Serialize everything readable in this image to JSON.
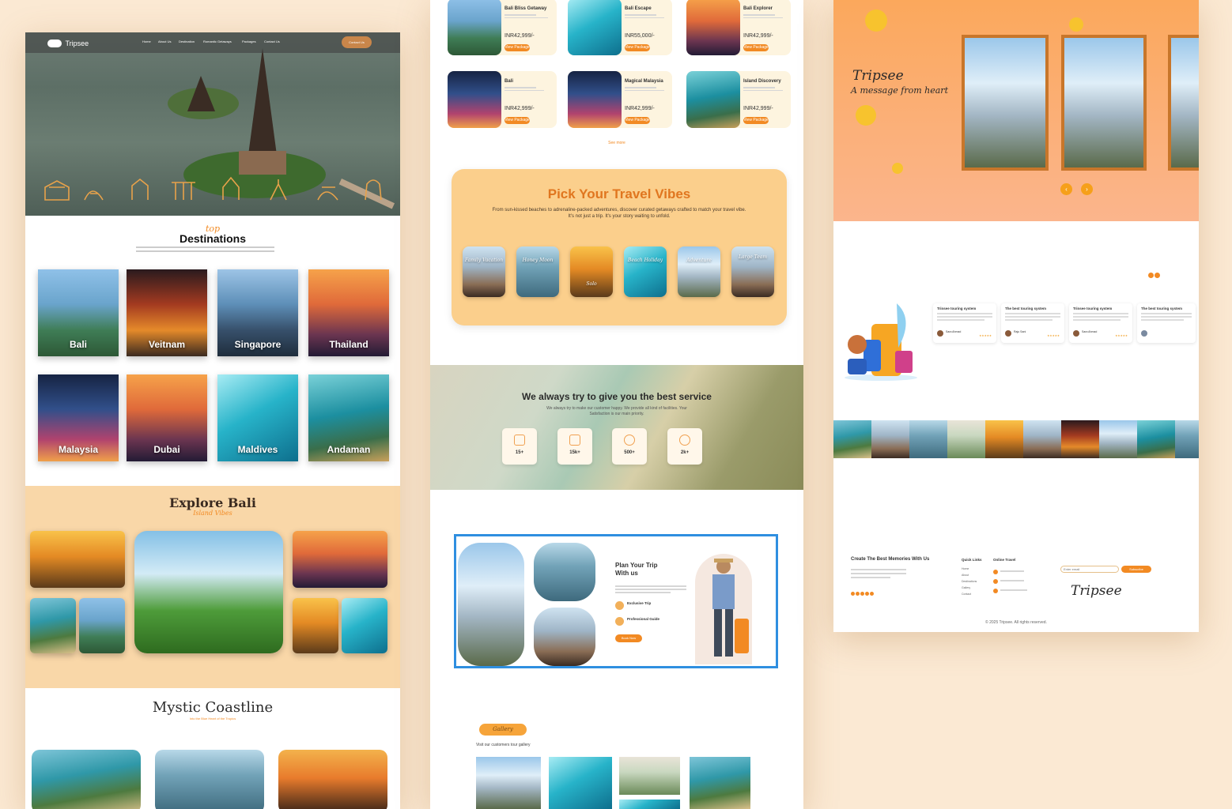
{
  "brand": {
    "name": "Tripsee"
  },
  "nav": {
    "links": [
      "Home",
      "About Us",
      "Destination",
      "Romantic Getaways",
      "Packages",
      "Contact Us"
    ],
    "cta": "Contact Us"
  },
  "destinations": {
    "kicker": "top",
    "title": "Destinations",
    "items": [
      "Bali",
      "Veitnam",
      "Singapore",
      "Thailand",
      "Malaysia",
      "Dubai",
      "Maldives",
      "Andaman"
    ]
  },
  "explore": {
    "title": "Explore Bali",
    "subtitle": "Island Vibes"
  },
  "coastline": {
    "title": "Mystic Coastline",
    "subtitle": "Into the Blue Heart of the Tropics"
  },
  "deals": {
    "items": [
      {
        "title": "Bali Bliss Getaway",
        "price": "INR42,999/-",
        "cta": "View Package"
      },
      {
        "title": "Bali Escape",
        "price": "INR55,000/-",
        "cta": "View Package"
      },
      {
        "title": "Bali Explorer",
        "price": "INR42,999/-",
        "cta": "View Package"
      },
      {
        "title": "Bali",
        "price": "INR42,999/-",
        "cta": "View Package"
      },
      {
        "title": "Magical Malaysia",
        "price": "INR42,999/-",
        "cta": "View Package"
      },
      {
        "title": "Island Discovery",
        "price": "INR42,999/-",
        "cta": "View Package"
      }
    ],
    "see_more": "See more"
  },
  "vibes": {
    "title": "Pick Your Travel Vibes",
    "desc": "From sun-kissed beaches to adrenaline-packed adventures, discover curated getaways crafted to match your travel vibe. It's not just a trip. It's your story waiting to unfold.",
    "items": [
      "Family Vacation",
      "Honey Moon",
      "Solo",
      "Beach Holiday",
      "Adventure",
      "Large Team"
    ]
  },
  "service": {
    "title": "We always try to give you the best service",
    "desc": "We always try to make our customer happy. We provide all kind of facilities. Your Satisfaction is our main priority.",
    "stats": [
      "15+",
      "15k+",
      "500+",
      "2k+"
    ]
  },
  "plan": {
    "title": "Plan Your Trip With us",
    "features": [
      "Exclusive Trip",
      "Professional Guide"
    ],
    "cta": "Book Now"
  },
  "gallery": {
    "badge": "Gallery",
    "caption": "Visit our customers tour gallery"
  },
  "message": {
    "brand": "Tripsee",
    "tagline": "A message from heart"
  },
  "testimonials": {
    "items": [
      {
        "heading": "Trinsee touring system",
        "name": "Sara Ahmad"
      },
      {
        "heading": "The best touring system",
        "name": "Raju Sani"
      },
      {
        "heading": "Trinsee touring system",
        "name": "Sara Ahmad"
      },
      {
        "heading": "The best touring system",
        "name": ""
      }
    ],
    "stars": "★★★★★"
  },
  "footer": {
    "headline": "Create The Best Memories With Us",
    "quick_links_title": "Quick Links",
    "quick_links": [
      "Home",
      "About",
      "Destinations",
      "Gallery",
      "Contact"
    ],
    "contact_title": "Online Travel",
    "newsletter_placeholder": "Enter email",
    "newsletter_button": "Subscribe",
    "logo": "Tripsee",
    "copyright": "© 2025 Tripsee. All rights reserved."
  },
  "colors": {
    "accent": "#f28a23",
    "peach": "#f9d7a8",
    "bg": "#fbe9d3"
  }
}
